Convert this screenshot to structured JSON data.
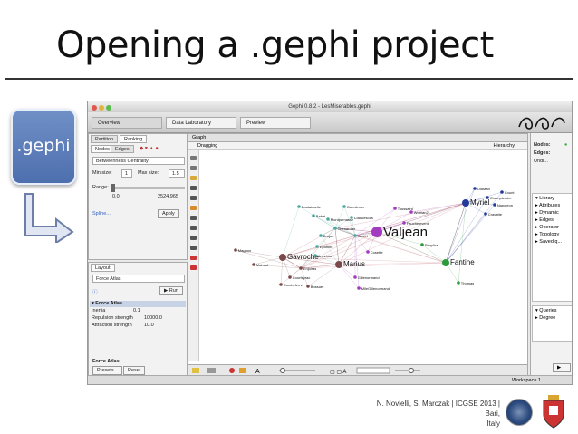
{
  "slide": {
    "title": "Opening a .gephi project",
    "badge_label": ".gephi",
    "footer_line1": "N. Novielli, S. Marczak | ICGSE 2013 | Bari,",
    "footer_line2": "Italy"
  },
  "app": {
    "window_title": "Gephi 0.8.2 - LesMiserables.gephi",
    "toolbar": {
      "overview": "Overview",
      "data_lab": "Data Laboratory",
      "preview": "Preview"
    },
    "ranking": {
      "tabs": [
        "Partition",
        "Ranking"
      ],
      "sub_tabs": [
        "Nodes",
        "Edges"
      ],
      "metric": "Betweenness Centrality",
      "min_size_label": "Min size:",
      "min_size": "1",
      "max_size_label": "Max size:",
      "max_size": "1.5",
      "range_label": "Range:",
      "range_min": "0.0",
      "range_max": "2524.965",
      "splines": "Spline...",
      "apply": "Apply"
    },
    "layout": {
      "tab": "Layout",
      "algorithm": "Force Atlas",
      "run": "Run",
      "section": "Force Atlas",
      "params": [
        {
          "name": "Inertia",
          "value": "0.1"
        },
        {
          "name": "Repulsion strength",
          "value": "10000.0"
        },
        {
          "name": "Attraction strength",
          "value": "10.0"
        }
      ],
      "footer_section": "Force Atlas",
      "presets": "Presets...",
      "reset": "Reset"
    },
    "graph": {
      "tab": "Graph",
      "sub": "Dragging",
      "hierarchy": "Hierarchy",
      "status": "Workspace 1"
    },
    "context": {
      "nodes_label": "Nodes:",
      "edges_label": "Edges:",
      "edges_value": "Undi..."
    },
    "filters": {
      "items": [
        "Library",
        "Attributes",
        "Dynamic",
        "Edges",
        "Operator",
        "Topology",
        "Saved q..."
      ],
      "queries": [
        "Queries",
        "Degree"
      ]
    }
  },
  "chart_data": {
    "type": "network",
    "nodes": [
      {
        "label": "Valjean",
        "color": "#a23bbf",
        "size": "large"
      },
      {
        "label": "Gavroche",
        "color": "#7a4a4a",
        "size": "medium"
      },
      {
        "label": "Marius",
        "color": "#7a4a4a",
        "size": "medium"
      },
      {
        "label": "Fantine",
        "color": "#2a9a3a",
        "size": "medium"
      },
      {
        "label": "Myriel",
        "color": "#223a9a",
        "size": "medium"
      },
      {
        "label": "Thenardier",
        "color": "#4aa8a0",
        "size": "small"
      },
      {
        "label": "Javert",
        "color": "#4aa8a0",
        "size": "small"
      },
      {
        "label": "Enjolras",
        "color": "#7a4a4a",
        "size": "small"
      },
      {
        "label": "Cosette",
        "color": "#a23bbf",
        "size": "small"
      },
      {
        "label": "Gillenormand",
        "color": "#a23bbf",
        "size": "small"
      },
      {
        "label": "MlleGillenormand",
        "color": "#a23bbf",
        "size": "small"
      },
      {
        "label": "Courfeyrac",
        "color": "#7a4a4a",
        "size": "small"
      },
      {
        "label": "Combeferre",
        "color": "#7a4a4a",
        "size": "small"
      },
      {
        "label": "Bossuet",
        "color": "#7a4a4a",
        "size": "small"
      },
      {
        "label": "Eponine",
        "color": "#4aa8a0",
        "size": "small"
      },
      {
        "label": "Thomas",
        "color": "#2a9a3a",
        "size": "small"
      },
      {
        "label": "Fauchelevent",
        "color": "#a23bbf",
        "size": "small"
      },
      {
        "label": "Simplice",
        "color": "#2a9a3a",
        "size": "small"
      },
      {
        "label": "Boulatruelle",
        "color": "#4aa8a0",
        "size": "small"
      },
      {
        "label": "Mabeuf",
        "color": "#7a4a4a",
        "size": "small"
      },
      {
        "label": "Montparnasse",
        "color": "#4aa8a0",
        "size": "small"
      },
      {
        "label": "Babet",
        "color": "#4aa8a0",
        "size": "small"
      },
      {
        "label": "Gueulemer",
        "color": "#4aa8a0",
        "size": "small"
      },
      {
        "label": "Claquesous",
        "color": "#4aa8a0",
        "size": "small"
      },
      {
        "label": "Champtercier",
        "color": "#223a9a",
        "size": "small"
      },
      {
        "label": "Napoleon",
        "color": "#223a9a",
        "size": "small"
      },
      {
        "label": "Cravatte",
        "color": "#223a9a",
        "size": "small"
      },
      {
        "label": "Count",
        "color": "#223a9a",
        "size": "small"
      },
      {
        "label": "OldMan",
        "color": "#223a9a",
        "size": "small"
      },
      {
        "label": "Toussaint",
        "color": "#a23bbf",
        "size": "small"
      },
      {
        "label": "Woman2",
        "color": "#a23bbf",
        "size": "small"
      },
      {
        "label": "Magnon",
        "color": "#7a4a4a",
        "size": "small"
      },
      {
        "label": "Brujon",
        "color": "#4aa8a0",
        "size": "small"
      },
      {
        "label": "Anzelma",
        "color": "#4aa8a0",
        "size": "small"
      }
    ]
  }
}
